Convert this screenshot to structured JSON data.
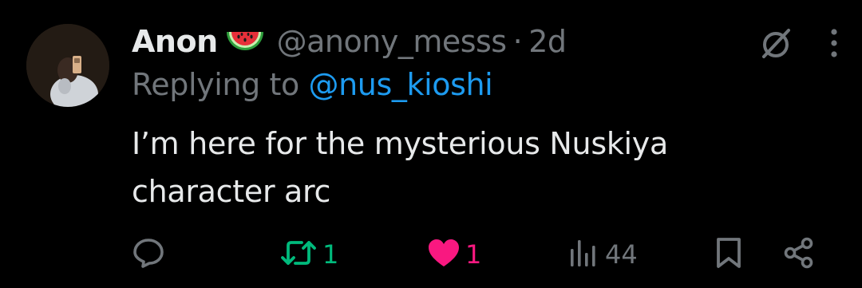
{
  "tweet": {
    "display_name": "Anon",
    "name_emoji": "watermelon",
    "handle": "@anony_messs",
    "separator": "·",
    "time": "2d",
    "replying_prefix": "Replying to ",
    "replying_to": "@nus_kioshi",
    "text_lines": [
      "I’m here for the mysterious Nuskiya",
      "character arc"
    ]
  },
  "actions": {
    "reply_count": "",
    "retweet_count": "1",
    "like_count": "1",
    "views_count": "44"
  },
  "icons": {
    "header": [
      "grok-icon",
      "more-vertical-icon"
    ],
    "actions": [
      "reply-icon",
      "retweet-icon",
      "heart-filled-icon",
      "views-icon",
      "bookmark-icon",
      "share-icon"
    ]
  },
  "colors": {
    "background": "#000000",
    "text_primary": "#e7e9ea",
    "text_secondary": "#71767b",
    "mention": "#1d9bf0",
    "retweet": "#00ba7c",
    "like": "#f91880"
  }
}
